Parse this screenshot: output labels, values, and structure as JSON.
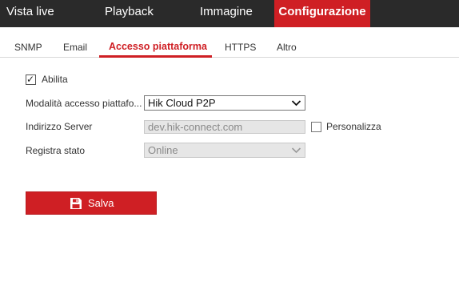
{
  "topnav": {
    "items": [
      {
        "label": "Vista live",
        "active": false
      },
      {
        "label": "Playback",
        "active": false
      },
      {
        "label": "Immagine",
        "active": false
      },
      {
        "label": "Configurazione",
        "active": true
      }
    ],
    "background": "#2a2a2a",
    "active_color": "#cf1f24"
  },
  "subtabs": {
    "items": [
      {
        "label": "SNMP",
        "active": false
      },
      {
        "label": "Email",
        "active": false
      },
      {
        "label": "Accesso piattaforma",
        "active": true
      },
      {
        "label": "HTTPS",
        "active": false
      },
      {
        "label": "Altro",
        "active": false
      }
    ]
  },
  "form": {
    "enable": {
      "label": "Abilita",
      "checked": true
    },
    "access_mode": {
      "label": "Modalità accesso piattafo...",
      "value": "Hik Cloud P2P"
    },
    "server_address": {
      "label": "Indirizzo Server",
      "value": "dev.hik-connect.com",
      "disabled": true
    },
    "customize": {
      "label": "Personalizza",
      "checked": false
    },
    "register_status": {
      "label": "Registra stato",
      "value": "Online",
      "disabled": true
    }
  },
  "save_button": {
    "label": "Salva",
    "icon": "save-icon"
  },
  "accent_color": "#cf1f24"
}
